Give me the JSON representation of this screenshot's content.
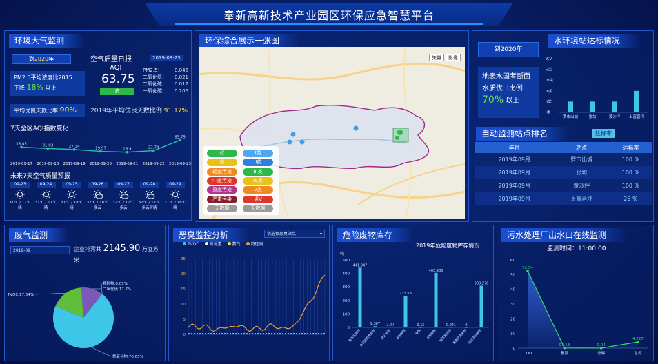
{
  "title": "奉新高新技术产业园区环保应急智慧平台",
  "air": {
    "head": "环境大气监测",
    "to2020": "到2020年",
    "to2020_year": "2020",
    "pm_line1": "PM2.5平均浓度比2015",
    "pm_line2": "下降",
    "pm_pct": "18%",
    "pm_suffix": "以上",
    "good_label": "平均优良天数比率",
    "good_pct": "90%",
    "aqi_title": "空气质量日报",
    "aqi_date": "2019-09-23",
    "aqi_label": "AQI",
    "aqi_value": "63.75",
    "aqi_grade": "良",
    "pollutants": [
      {
        "name": "PM2.5：",
        "value": "0.046"
      },
      {
        "name": "二氧化氮：",
        "value": "0.021"
      },
      {
        "name": "二氧化硫：",
        "value": "0.012"
      },
      {
        "name": "一氧化碳：",
        "value": "0.206"
      }
    ],
    "ratio_label": "2019年平均优良天数比例",
    "ratio_value": "91.17%",
    "trend_title": "7天全区AQI指数变化",
    "trend": {
      "x": [
        "2019-09-17",
        "2019-09-18",
        "2019-09-19",
        "2019-09-20",
        "2019-09-21",
        "2019-09-22",
        "2019-09-23"
      ],
      "values": [
        36.45,
        31.03,
        27.34,
        19.97,
        16.9,
        22.74,
        63.75
      ],
      "labels": [
        "36.45",
        "31.03",
        "27.34",
        "19.97",
        "16.9",
        "22.74",
        "63.75"
      ]
    },
    "forecast_title": "未来7天空气质量预报",
    "forecast": [
      {
        "date": "09-23",
        "temp": "31℃ / 17℃",
        "desc": "晴"
      },
      {
        "date": "09-24",
        "temp": "31℃ / 17℃",
        "desc": "晴"
      },
      {
        "date": "09-25",
        "temp": "31℃ / 18℃",
        "desc": "晴"
      },
      {
        "date": "09-26",
        "temp": "32℃ / 18℃",
        "desc": "多云"
      },
      {
        "date": "09-27",
        "temp": "32℃ / 17℃",
        "desc": "多云"
      },
      {
        "date": "09-28",
        "temp": "32℃ / 17℃",
        "desc": "多云转晴"
      },
      {
        "date": "09-29",
        "temp": "31℃ / 18℃",
        "desc": "晴"
      }
    ]
  },
  "map": {
    "head": "环保综合展示一张图",
    "btn_map": "矢量",
    "btn_sat": "影像",
    "legend_left": [
      {
        "label": "优",
        "color": "#2fb84a"
      },
      {
        "label": "良",
        "color": "#e6c21a"
      },
      {
        "label": "轻度污染",
        "color": "#f08a1e"
      },
      {
        "label": "中度污染",
        "color": "#e0362a"
      },
      {
        "label": "重度污染",
        "color": "#b0368e"
      },
      {
        "label": "严重污染",
        "color": "#8a1c30"
      },
      {
        "label": "无数据",
        "color": "#9a9a9a"
      }
    ],
    "legend_right": [
      {
        "label": "I类",
        "color": "#4fa7f2"
      },
      {
        "label": "II类",
        "color": "#2f7ee0"
      },
      {
        "label": "III类",
        "color": "#2fb84a"
      },
      {
        "label": "IV类",
        "color": "#e6c21a"
      },
      {
        "label": "V类",
        "color": "#f08a1e"
      },
      {
        "label": "劣V",
        "color": "#e0362a"
      },
      {
        "label": "无数据",
        "color": "#9a9a9a"
      }
    ]
  },
  "water": {
    "head": "水环境站达标情况",
    "to2020": "到2020年",
    "text1": "地表水国考断面",
    "text2": "水质优III比例",
    "pct": "70%",
    "suffix": "以上",
    "chart_data": {
      "type": "bar",
      "categories": [
        "罗市出城",
        "张坊",
        "黄沙坪",
        "上富晋坪"
      ],
      "values": [
        1,
        1,
        1,
        2
      ],
      "y_tick_labels": [
        "劣V",
        "V类",
        "IV类",
        "III类",
        "II类",
        "I类"
      ]
    }
  },
  "ranking": {
    "head": "自动监测站点排名",
    "button": "达标率",
    "columns": [
      "年月",
      "站点",
      "达标率"
    ],
    "rows": [
      [
        "2019年09月",
        "罗市出城",
        "100 %"
      ],
      [
        "2019年09月",
        "张坊",
        "100 %"
      ],
      [
        "2019年09月",
        "黄沙坪",
        "100 %"
      ],
      [
        "2019年09月",
        "上富晋坪",
        "25 %"
      ]
    ]
  },
  "waste_gas": {
    "head": "废气监测",
    "date": "2019-09",
    "total_label": "企业排污共",
    "total_value": "2145.90",
    "unit": "万立方米",
    "chart_data": {
      "type": "pie",
      "slices": [
        {
          "label": "氮氧化物:70.65%",
          "value": 70.65,
          "color": "#3ec6e8"
        },
        {
          "label": "TVOC:17.64%",
          "value": 17.64,
          "color": "#5fbf3a"
        },
        {
          "label": "二氧化硫:11.7%",
          "value": 11.7,
          "color": "#7a5ab8"
        },
        {
          "label": "颗粒物:0.01%",
          "value": 0.01,
          "color": "#e04a4a"
        }
      ]
    }
  },
  "odor": {
    "head": "恶臭监控分析",
    "select": "请选择恶臭站点",
    "chart_data": {
      "type": "line",
      "legend": [
        "TVOC",
        "硫化氢",
        "氨气",
        "特征臭"
      ],
      "ylim": [
        0,
        25
      ],
      "yticks": [
        0,
        5,
        10,
        15,
        20,
        25
      ]
    }
  },
  "hazard": {
    "head": "危险废物库存",
    "subtitle": "2019年危险废物库存情况",
    "y_unit": "吨",
    "chart_data": {
      "type": "bar",
      "categories": [
        "废有机溶剂",
        "有机树脂类废物",
        "废矿物油",
        "含铬废物",
        "废酸",
        "含铜废物",
        "精蒸馏残渣",
        "表面处理废物",
        "染料涂料废物"
      ],
      "values": [
        441.947,
        9.307,
        3.07,
        233.58,
        0.15,
        403.986,
        0.941,
        0,
        308.276
      ],
      "labels": [
        "441.947",
        "9.307",
        "3.07",
        "233.58",
        "0.15",
        "403.986",
        "0.941",
        "0",
        "308.276"
      ],
      "ylim": [
        0,
        500
      ],
      "yticks": [
        0,
        100,
        200,
        300,
        400,
        500
      ]
    }
  },
  "sewage": {
    "head": "污水处理厂出水口在线监测",
    "time_label": "监测时间：",
    "time_value": "11:00:00",
    "chart_data": {
      "type": "line",
      "categories": [
        "COD",
        "氨氮",
        "总磷",
        "总氮"
      ],
      "values": [
        52.54,
        0.113,
        0.04,
        4.227
      ],
      "labels": [
        "52.54",
        "0.113",
        "0.04",
        "4.227"
      ],
      "ylim": [
        0,
        60
      ],
      "yticks": [
        0,
        10,
        20,
        30,
        40,
        50,
        60
      ]
    }
  }
}
